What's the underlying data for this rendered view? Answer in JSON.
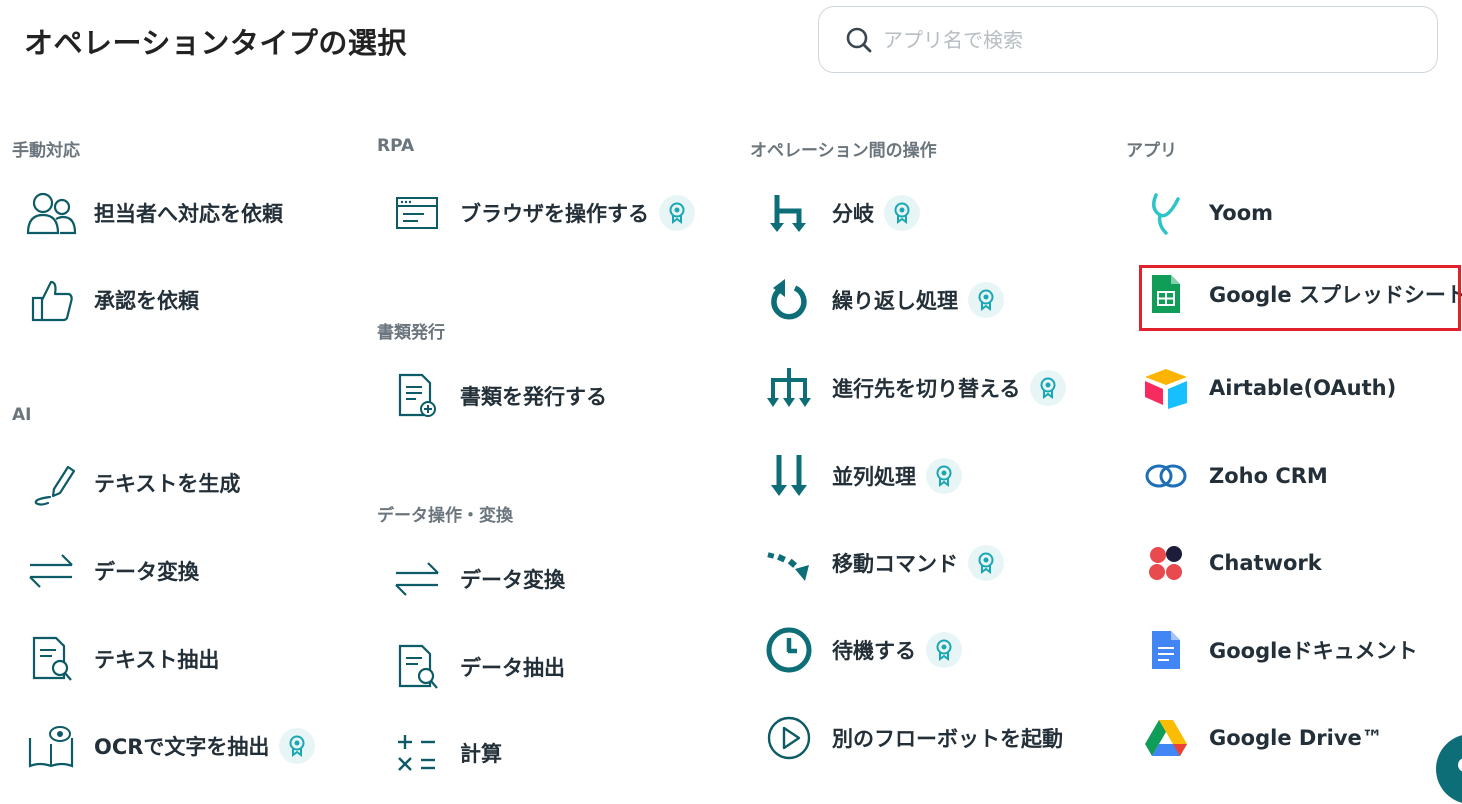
{
  "page": {
    "title": "オペレーションタイプの選択"
  },
  "search": {
    "placeholder": "アプリ名で検索",
    "value": ""
  },
  "sections": {
    "manual": {
      "label": "手動対応",
      "items": [
        "担当者へ対応を依頼",
        "承認を依頼"
      ]
    },
    "ai": {
      "label": "AI",
      "items": [
        "テキストを生成",
        "データ変換",
        "テキスト抽出",
        "OCRで文字を抽出"
      ]
    },
    "rpa": {
      "label": "RPA",
      "items": [
        "ブラウザを操作する"
      ]
    },
    "docs": {
      "label": "書類発行",
      "items": [
        "書類を発行する"
      ]
    },
    "data": {
      "label": "データ操作・変換",
      "items": [
        "データ変換",
        "データ抽出",
        "計算"
      ]
    },
    "ops": {
      "label": "オペレーション間の操作",
      "items": [
        "分岐",
        "繰り返し処理",
        "進行先を切り替える",
        "並列処理",
        "移動コマンド",
        "待機する",
        "別のフローボットを起動"
      ]
    },
    "apps": {
      "label": "アプリ",
      "items": [
        "Yoom",
        "Google スプレッドシート",
        "Airtable(OAuth)",
        "Zoho CRM",
        "Chatwork",
        "Googleドキュメント",
        "Google Drive™"
      ]
    }
  },
  "colors": {
    "accent": "#0d6e78",
    "highlight": "#e0202a",
    "badge_bg": "#e7f5f6"
  },
  "selected_app": "Google スプレッドシート"
}
